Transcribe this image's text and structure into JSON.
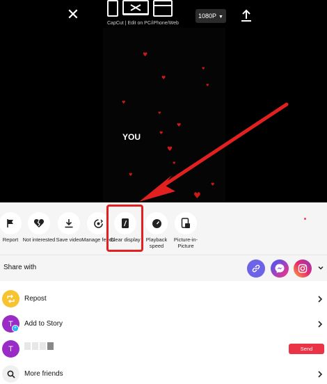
{
  "video": {
    "quality_label": "1080P",
    "capcut_caption": "CapCut | Edit on PC/iPhone/Web",
    "overlay_text": "YOU"
  },
  "actions": [
    {
      "label": "Report",
      "icon": "flag-icon"
    },
    {
      "label": "Not interested",
      "icon": "broken-heart-icon"
    },
    {
      "label": "Save video",
      "icon": "download-icon"
    },
    {
      "label": "Manage feeds",
      "icon": "manage-feeds-icon"
    },
    {
      "label": "Clear display",
      "icon": "clear-display-icon"
    },
    {
      "label": "Playback speed",
      "icon": "playback-speed-icon"
    },
    {
      "label": "Picture-in-Picture",
      "icon": "picture-in-picture-icon"
    }
  ],
  "share": {
    "title": "Share with",
    "apps": [
      "copy-link-icon",
      "messenger-icon",
      "instagram-icon"
    ]
  },
  "list": {
    "repost": "Repost",
    "add_to_story": "Add to Story",
    "avatar_letter": "T",
    "send_label": "Send",
    "more_friends": "More friends"
  },
  "colors": {
    "highlight_red": "#e32020",
    "send_red": "#ea3344",
    "heart_red": "#d01818",
    "repost_yellow": "#f7c32e",
    "avatar_purple": "#9b2bc6",
    "link_purple": "#6c63e8"
  }
}
